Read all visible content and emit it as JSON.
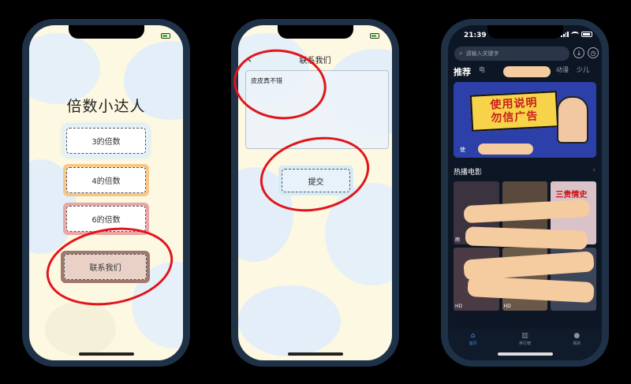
{
  "screen1": {
    "title": "倍数小达人",
    "buttons": [
      {
        "label": "3的倍数"
      },
      {
        "label": "4的倍数"
      },
      {
        "label": "6的倍数"
      },
      {
        "label": "联系我们"
      }
    ]
  },
  "screen2": {
    "back_icon": "‹",
    "title": "联系我们",
    "feedback_value": "皮皮真不错",
    "submit_label": "提交"
  },
  "screen3": {
    "status_time": "21:39",
    "search_placeholder": "请输入关键字",
    "top_icons": [
      "download-icon",
      "history-icon"
    ],
    "categories": [
      {
        "label": "推荐",
        "active": true
      },
      {
        "label": "电"
      },
      {
        "label": "动漫"
      },
      {
        "label": "少儿"
      }
    ],
    "banner": {
      "text_line1": "使用说明",
      "text_line2": "勿信广告",
      "caption": "使"
    },
    "section_title": "热播电影",
    "section_chevron": "›",
    "posters": [
      {
        "caption": "雨",
        "title": ""
      },
      {
        "caption": "",
        "title": ""
      },
      {
        "caption": "",
        "title": "三贵情史"
      },
      {
        "caption": "HD",
        "title": ""
      },
      {
        "caption": "HD",
        "title": ""
      },
      {
        "caption": "",
        "title": ""
      }
    ],
    "tabs": [
      {
        "label": "首页",
        "icon": "⌂",
        "active": true
      },
      {
        "label": "排行榜",
        "icon": "▥"
      },
      {
        "label": "我的",
        "icon": "●"
      }
    ]
  },
  "colors": {
    "annotation_red": "#e1141a",
    "dark_bg": "#0c1624",
    "accent_blue": "#3f8ef2"
  }
}
